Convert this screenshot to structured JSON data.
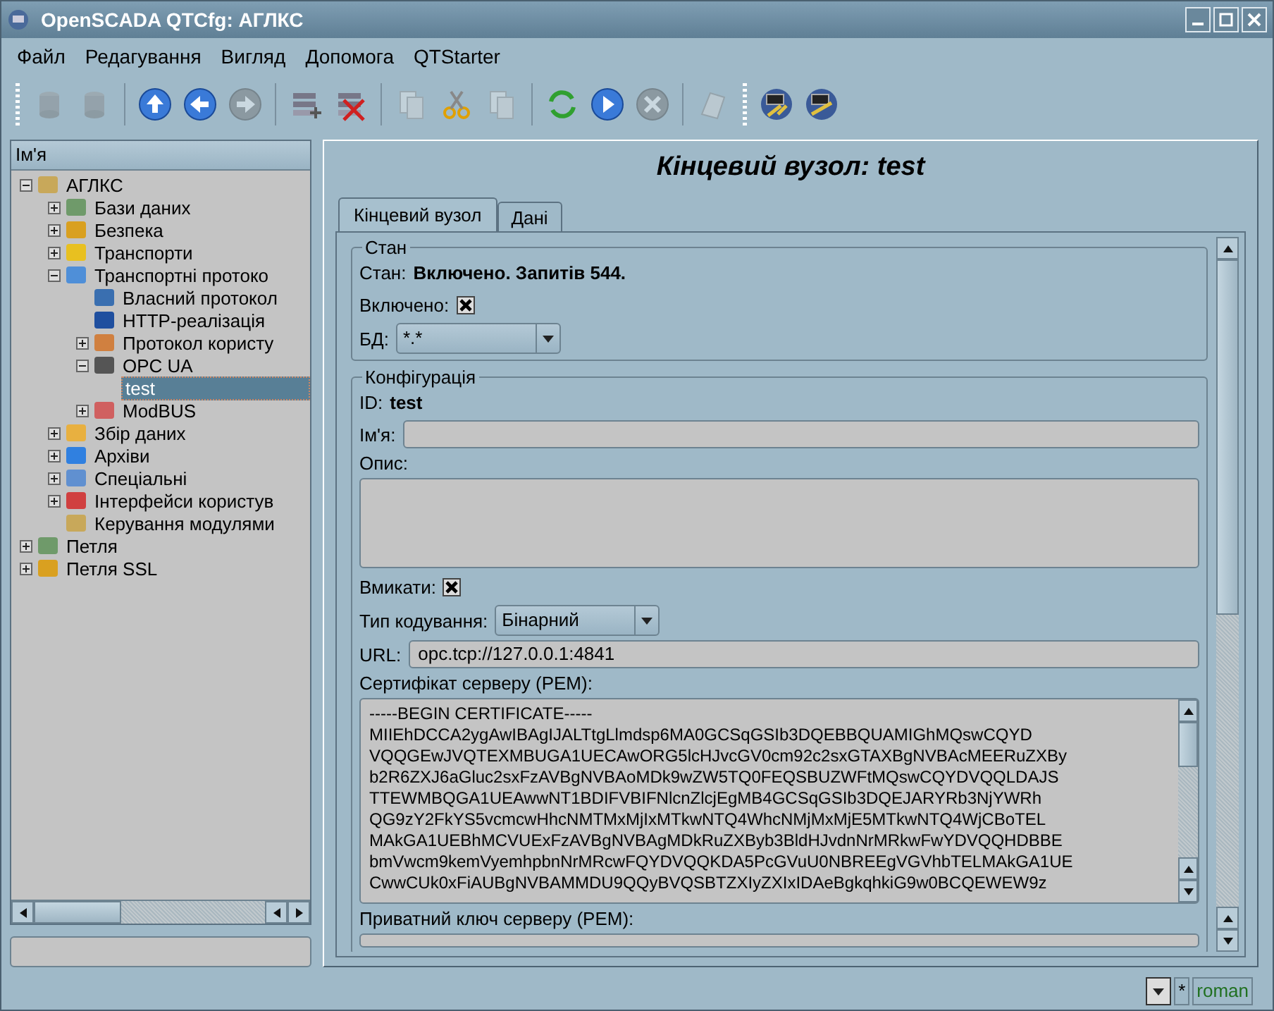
{
  "window": {
    "title": "OpenSCADA QTCfg: АГЛКС"
  },
  "menu": [
    {
      "label": "Файл"
    },
    {
      "label": "Редагування"
    },
    {
      "label": "Вигляд"
    },
    {
      "label": "Допомога"
    },
    {
      "label": "QTStarter"
    }
  ],
  "toolbar": [
    [
      {
        "disabled": true
      },
      {
        "disabled": true
      }
    ],
    [
      {
        "disabled": false
      },
      {
        "disabled": false
      },
      {
        "disabled": true
      }
    ],
    [
      {
        "disabled": false
      },
      {
        "disabled": false
      }
    ],
    [
      {
        "disabled": true
      },
      {
        "disabled": false
      },
      {
        "disabled": true
      }
    ],
    [
      {
        "disabled": false
      },
      {
        "disabled": false
      },
      {
        "disabled": true
      }
    ],
    [
      {
        "disabled": true
      }
    ],
    [
      {
        "disabled": false
      },
      {
        "disabled": false
      }
    ]
  ],
  "tree": {
    "header": "Ім'я",
    "items": [
      {
        "label": "АГЛКС",
        "expanded": true,
        "selected": false,
        "children": [
          {
            "label": "Бази даних",
            "expanded": false,
            "selected": false
          },
          {
            "label": "Безпека",
            "expanded": false,
            "selected": false
          },
          {
            "label": "Транспорти",
            "expanded": false,
            "selected": false
          },
          {
            "label": "Транспортні протоко",
            "expanded": true,
            "selected": false,
            "children": [
              {
                "label": "Власний протокол",
                "selected": false
              },
              {
                "label": "HTTP-реалізація",
                "selected": false
              },
              {
                "label": "Протокол користу",
                "expanded": false,
                "selected": false
              },
              {
                "label": "OPC UA",
                "expanded": true,
                "selected": false,
                "children": [
                  {
                    "label": "test",
                    "selected": true
                  }
                ]
              },
              {
                "label": "ModBUS",
                "expanded": false,
                "selected": false
              }
            ]
          },
          {
            "label": "Збір даних",
            "expanded": false,
            "selected": false
          },
          {
            "label": "Архіви",
            "expanded": false,
            "selected": false
          },
          {
            "label": "Спеціальні",
            "expanded": false,
            "selected": false
          },
          {
            "label": "Інтерфейси користув",
            "expanded": false,
            "selected": false
          },
          {
            "label": "Керування модулями",
            "selected": false
          }
        ]
      },
      {
        "label": "Петля",
        "expanded": false,
        "selected": false
      },
      {
        "label": "Петля SSL",
        "expanded": false,
        "selected": false
      }
    ]
  },
  "page": {
    "title": "Кінцевий вузол: test",
    "tabs": [
      {
        "label": "Кінцевий вузол",
        "selected": true
      },
      {
        "label": "Дані",
        "selected": false
      }
    ],
    "groups": [
      {
        "title": "Стан",
        "rows": [
          {
            "kind": "text",
            "label": "Стан:",
            "value": "Включено. Запитів 544."
          },
          {
            "kind": "checkbox",
            "label": "Включено:",
            "checked": true
          },
          {
            "kind": "select",
            "label": "БД:",
            "value": "*.*"
          }
        ]
      },
      {
        "title": "Конфігурація",
        "rows": [
          {
            "kind": "text",
            "label": "ID:",
            "value": "test"
          },
          {
            "kind": "input",
            "label": "Ім'я:"
          },
          {
            "kind": "textarea",
            "label": "Опис:"
          },
          {
            "kind": "checkbox",
            "label": "Вмикати:",
            "checked": true
          },
          {
            "kind": "select",
            "label": "Тип кодування:",
            "value": "Бінарний"
          },
          {
            "kind": "input",
            "label": "URL:",
            "value": "opc.tcp://127.0.0.1:4841"
          },
          {
            "kind": "textarea",
            "label": "Сертифікат серверу (PEM):",
            "lines": [
              "-----BEGIN CERTIFICATE-----",
              "MIIEhDCCA2ygAwIBAgIJALTtgLlmdsp6MA0GCSqGSIb3DQEBBQUAMIGhMQswCQYD",
              "VQQGEwJVQTEXMBUGA1UECAwORG5lcHJvcGV0cm92c2sxGTAXBgNVBAcMEERuZXBy",
              "b2R6ZXJ6aGluc2sxFzAVBgNVBAoMDk9wZW5TQ0FEQSBUZWFtMQswCQYDVQQLDAJS",
              "TTEWMBQGA1UEAwwNT1BDIFVBIFNlcnZlcjEgMB4GCSqGSIb3DQEJARYRb3NjYWRh",
              "QG9zY2FkYS5vcmcwHhcNMTMxMjIxMTkwNTQ4WhcNMjMxMjE5MTkwNTQ4WjCBoTEL",
              "MAkGA1UEBhMCVUExFzAVBgNVBAgMDkRuZXByb3BldHJvdnNrMRkwFwYDVQQHDBBE",
              "bmVwcm9kemVyemhpbnNrMRcwFQYDVQQKDA5PcGVuU0NBREEgVGVhbTELMAkGA1UE",
              "CwwCUk0xFiAUBgNVBAMMDU9QQyBVQSBTZXIyZXIxIDAeBgkqhkiG9w0BCQEWEW9z"
            ]
          },
          {
            "kind": "textarea",
            "label": "Приватний ключ серверу (PEM):"
          }
        ]
      }
    ]
  },
  "status_bar": {
    "modified": "*",
    "user": "roman"
  }
}
